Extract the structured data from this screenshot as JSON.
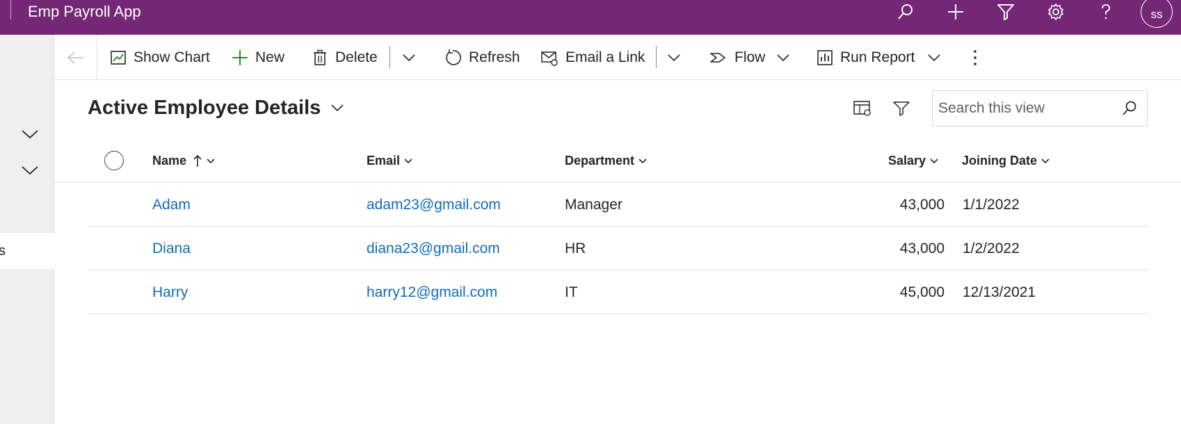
{
  "app": {
    "title": "Emp Payroll App",
    "user_initials": "SS"
  },
  "topbar_icons": [
    "search-icon",
    "plus-icon",
    "filter-icon",
    "gear-icon",
    "help-icon"
  ],
  "commands": {
    "show_chart": "Show Chart",
    "new": "New",
    "delete": "Delete",
    "refresh": "Refresh",
    "email_link": "Email a Link",
    "flow": "Flow",
    "run_report": "Run Report"
  },
  "leftnav": {
    "selected_item_text": "s"
  },
  "view": {
    "title": "Active Employee Details"
  },
  "search": {
    "placeholder": "Search this view",
    "value": ""
  },
  "grid": {
    "columns": {
      "name": "Name",
      "email": "Email",
      "department": "Department",
      "salary": "Salary",
      "joining_date": "Joining Date"
    },
    "sort": {
      "column": "Name",
      "direction": "ascending"
    },
    "rows": [
      {
        "name": "Adam",
        "email": "adam23@gmail.com",
        "department": "Manager",
        "salary": "43,000",
        "joining_date": "1/1/2022"
      },
      {
        "name": "Diana",
        "email": "diana23@gmail.com",
        "department": "HR",
        "salary": "43,000",
        "joining_date": "1/2/2022"
      },
      {
        "name": "Harry",
        "email": "harry12@gmail.com",
        "department": "IT",
        "salary": "45,000",
        "joining_date": "12/13/2021"
      }
    ]
  },
  "colors": {
    "topbar": "#742774",
    "link": "#0f6cbd",
    "leftnav": "#efefef",
    "accent_green": "#107c10"
  }
}
